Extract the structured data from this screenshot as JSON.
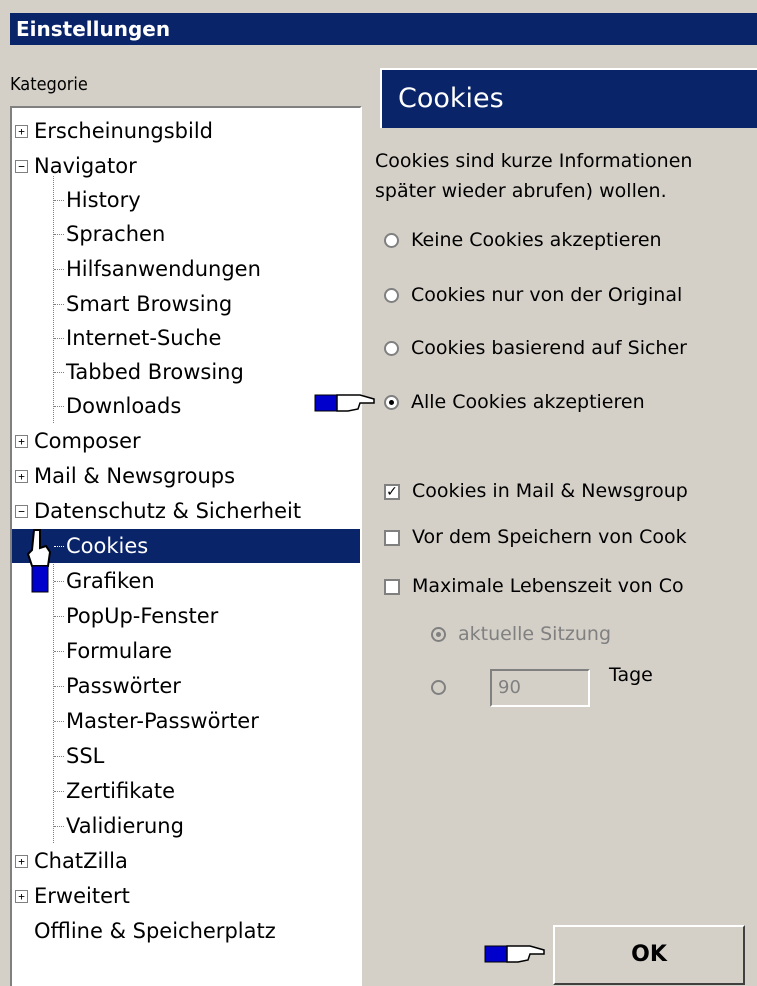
{
  "window": {
    "title": "Einstellungen"
  },
  "category_label": "Kategorie",
  "tree": {
    "appearance": "Erscheinungsbild",
    "navigator": "Navigator",
    "history": "History",
    "languages": "Sprachen",
    "helper_apps": "Hilfsanwendungen",
    "smart_browsing": "Smart Browsing",
    "internet_search": "Internet-Suche",
    "tabbed_browsing": "Tabbed Browsing",
    "downloads": "Downloads",
    "composer": "Composer",
    "mail_news": "Mail & Newsgroups",
    "privacy_security": "Datenschutz & Sicherheit",
    "cookies": "Cookies",
    "images": "Grafiken",
    "popups": "PopUp-Fenster",
    "forms": "Formulare",
    "passwords": "Passwörter",
    "master_passwords": "Master-Passwörter",
    "ssl": "SSL",
    "certificates": "Zertifikate",
    "validation": "Validierung",
    "chatzilla": "ChatZilla",
    "advanced": "Erweitert",
    "offline": "Offline & Speicherplatz"
  },
  "panel": {
    "title": "Cookies",
    "description_line1": "Cookies sind kurze Informationen",
    "description_line2": "später wieder abrufen) wollen.",
    "radio_none": "Keine Cookies akzeptieren",
    "radio_origin": "Cookies nur von der Original",
    "radio_security": "Cookies basierend auf Sicher",
    "radio_all": "Alle Cookies akzeptieren",
    "check_mail": "Cookies in Mail & Newsgroup",
    "check_ask": "Vor dem Speichern von Cook",
    "check_lifetime": "Maximale Lebenszeit von Co",
    "radio_session": "aktuelle Sitzung",
    "days_value": "90",
    "days_label": "Tage"
  },
  "buttons": {
    "ok": "OK"
  },
  "colors": {
    "selection": "#0a246a",
    "face": "#d4d0c8",
    "pointer_cuff": "#0000cc"
  }
}
